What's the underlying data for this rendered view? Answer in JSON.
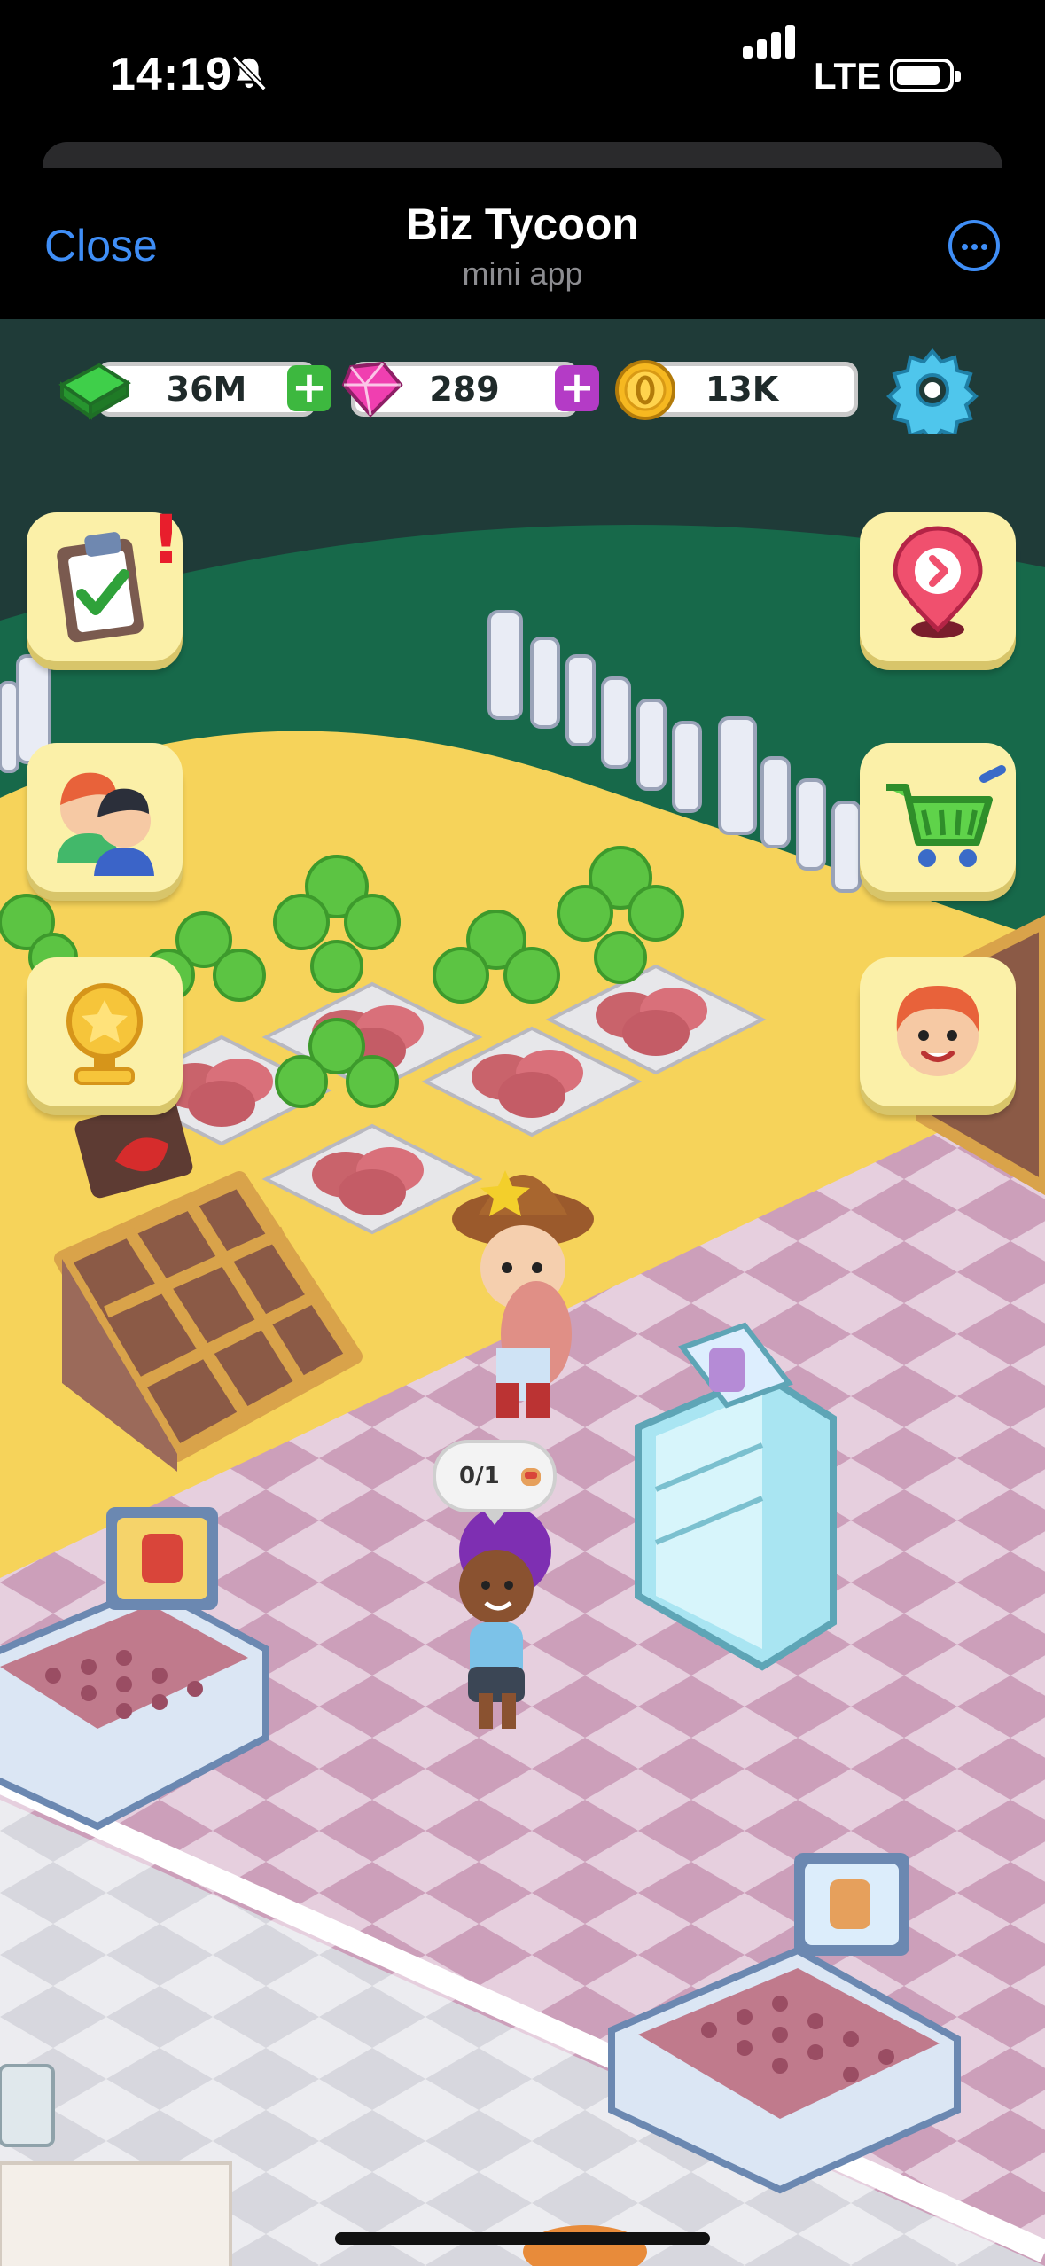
{
  "status_bar": {
    "time": "14:19",
    "network": "LTE",
    "icons": [
      "bell-slash-icon",
      "signal-bars-icon",
      "battery-icon"
    ]
  },
  "header": {
    "close_label": "Close",
    "title": "Biz Tycoon",
    "subtitle": "mini app",
    "more_icon": "ellipsis-circle-icon",
    "accent_color": "#3f8ef7"
  },
  "resources": {
    "cash": {
      "value": "36M",
      "icon": "green-cash-icon",
      "add_icon": "plus-icon",
      "add_color": "#3db83f"
    },
    "gems": {
      "value": "289",
      "icon": "pink-gem-icon",
      "add_icon": "plus-icon",
      "add_color": "#b43bc6"
    },
    "coins": {
      "value": "13K",
      "icon": "gold-coin-icon"
    },
    "settings_icon": "gear-icon"
  },
  "side_buttons": {
    "left": [
      "tasks-clipboard-icon",
      "staff-people-icon",
      "trophy-icon"
    ],
    "right": [
      "map-pin-icon",
      "shopping-cart-icon",
      "manager-face-icon"
    ],
    "tasks_alert": "!"
  },
  "scene": {
    "customer_order": "0/1",
    "order_item_icon": "burrito-icon"
  }
}
